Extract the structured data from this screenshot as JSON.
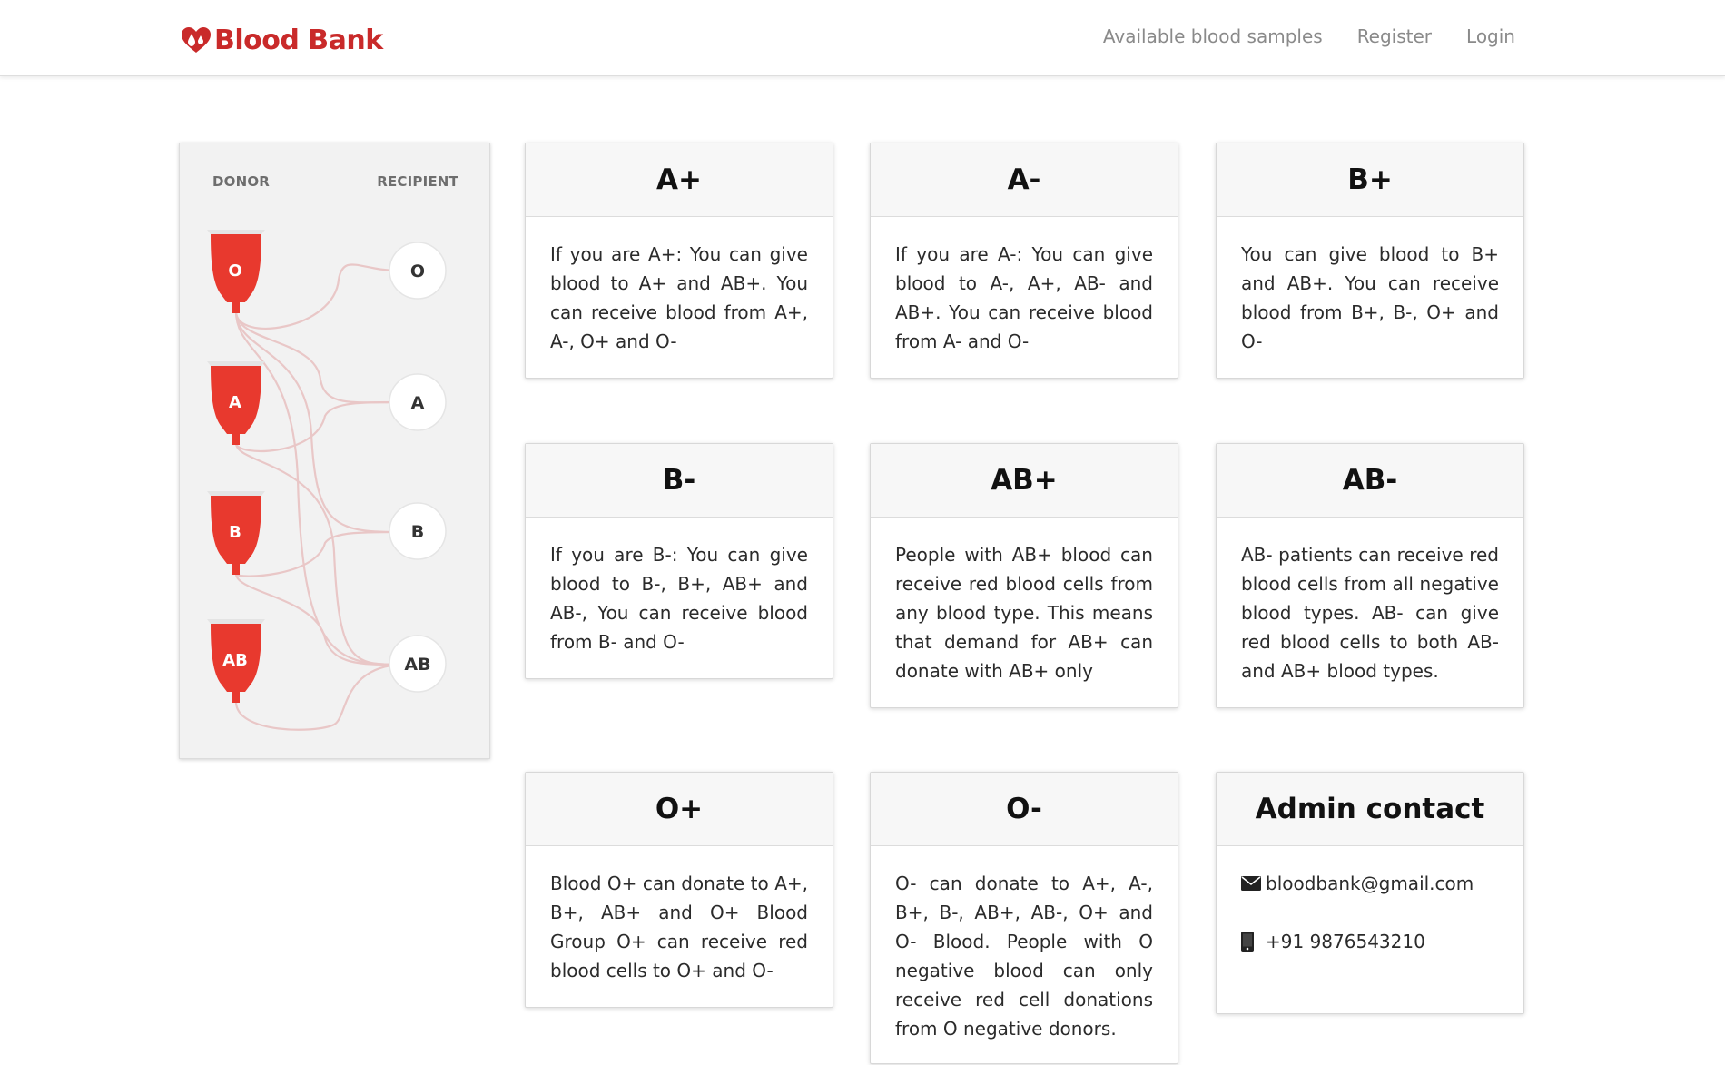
{
  "navbar": {
    "brand": "Blood Bank",
    "links": [
      "Available blood samples",
      "Register",
      "Login"
    ]
  },
  "diagram": {
    "donor_label": "DONOR",
    "recipient_label": "RECIPIENT",
    "donors": [
      "O",
      "A",
      "B",
      "AB"
    ],
    "recipients": [
      "O",
      "A",
      "B",
      "AB"
    ],
    "bag_color": "#e8392e"
  },
  "cards": [
    {
      "title": "A+",
      "text": "If you are A+: You can give blood to A+ and AB+. You can receive blood from A+, A-, O+ and O-"
    },
    {
      "title": "A-",
      "text": "If you are A-: You can give blood to A-, A+, AB- and AB+. You can receive blood from A- and O-"
    },
    {
      "title": "B+",
      "text": "You can give blood to B+ and AB+. You can receive blood from B+, B-, O+ and O-"
    },
    {
      "title": "B-",
      "text": "If you are B-: You can give blood to B-, B+, AB+ and AB-, You can receive blood from B- and O-"
    },
    {
      "title": "AB+",
      "text": "People with AB+ blood can receive red blood cells from any blood type. This means that demand for AB+ can donate with AB+ only"
    },
    {
      "title": "AB-",
      "text": "AB- patients can receive red blood cells from all negative blood types. AB- can give red blood cells to both AB- and AB+ blood types."
    },
    {
      "title": "O+",
      "text": "Blood O+ can donate to A+, B+, AB+ and O+ Blood Group O+ can receive red blood cells to O+ and O-"
    },
    {
      "title": "O-",
      "text": "O- can donate to A+, A-, B+, B-, AB+, AB-, O+ and O- Blood. People with O negative blood can only receive red cell donations from O negative donors."
    }
  ],
  "contact": {
    "title": "Admin contact",
    "email": "bloodbank@gmail.com",
    "phone": "+91 9876543210"
  },
  "colors": {
    "brand": "#c92a2a",
    "bag": "#e8392e"
  }
}
